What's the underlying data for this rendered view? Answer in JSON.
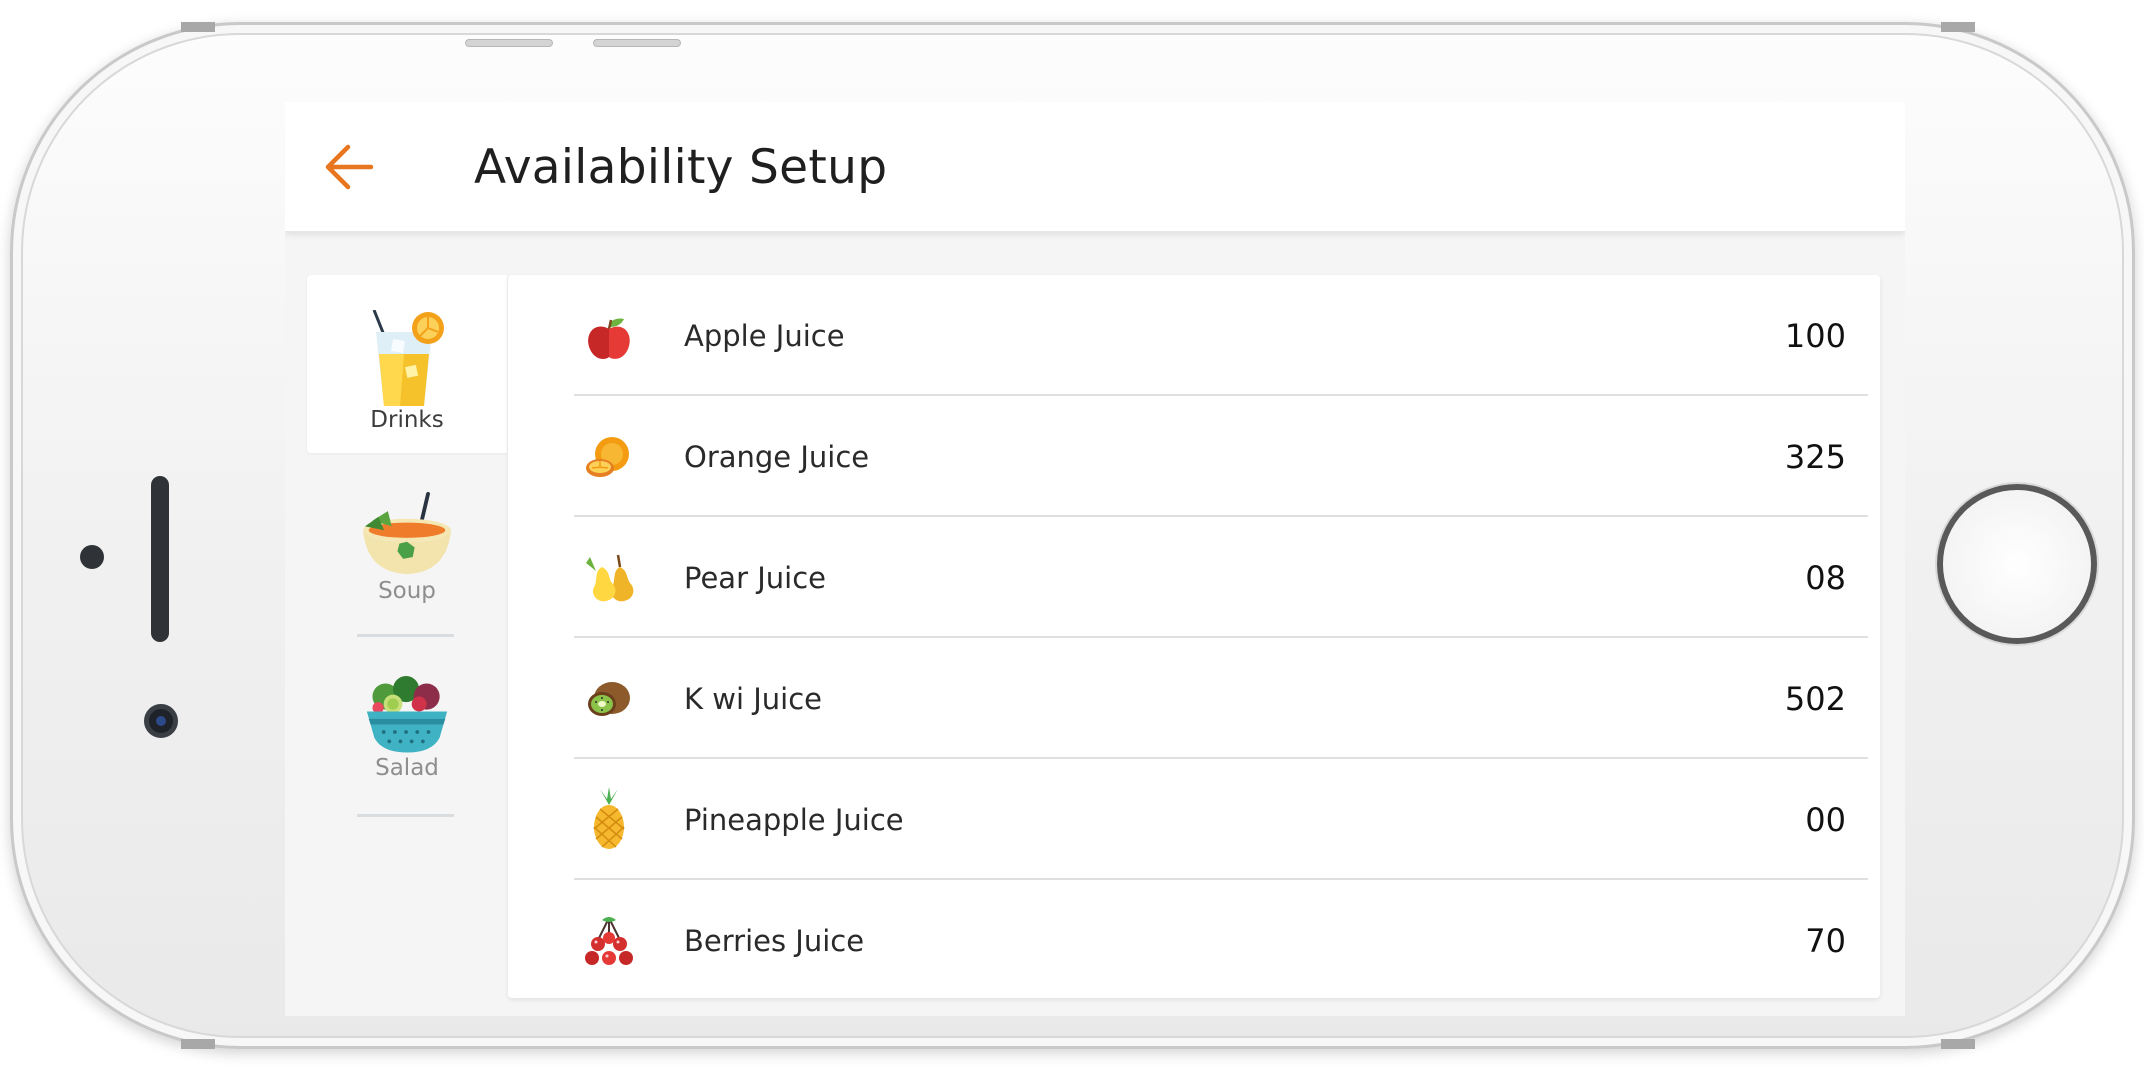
{
  "header": {
    "title": "Availability Setup",
    "back_icon": "arrow-left-icon",
    "accent_color": "#e8761f"
  },
  "categories": [
    {
      "label": "Drinks",
      "icon": "juice-glass-icon",
      "selected": true
    },
    {
      "label": "Soup",
      "icon": "soup-bowl-icon",
      "selected": false
    },
    {
      "label": "Salad",
      "icon": "salad-bowl-icon",
      "selected": false
    }
  ],
  "items": [
    {
      "name": "Apple Juice",
      "count": "100",
      "icon": "apple-icon"
    },
    {
      "name": "Orange Juice",
      "count": "325",
      "icon": "orange-icon"
    },
    {
      "name": "Pear Juice",
      "count": "08",
      "icon": "pear-icon"
    },
    {
      "name": "K wi Juice",
      "count": "502",
      "icon": "kiwi-icon"
    },
    {
      "name": "Pineapple Juice",
      "count": "00",
      "icon": "pineapple-icon"
    },
    {
      "name": "Berries Juice",
      "count": "70",
      "icon": "berries-icon"
    }
  ]
}
